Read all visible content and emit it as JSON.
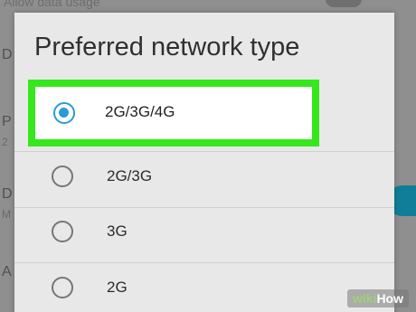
{
  "background": {
    "top_label": "Allow data usage",
    "edge_letters": [
      "D",
      "P",
      "D",
      "A"
    ],
    "edge_sub": [
      "2",
      "M"
    ]
  },
  "dialog": {
    "title": "Preferred network type",
    "options": [
      {
        "label": "2G/3G/4G",
        "selected": true
      },
      {
        "label": "2G/3G",
        "selected": false
      },
      {
        "label": "3G",
        "selected": false
      },
      {
        "label": "2G",
        "selected": false
      }
    ]
  },
  "highlight_color": "#35e81c",
  "accent_color": "#2a9bd8",
  "watermark": {
    "prefix": "wiki",
    "suffix": "How"
  }
}
